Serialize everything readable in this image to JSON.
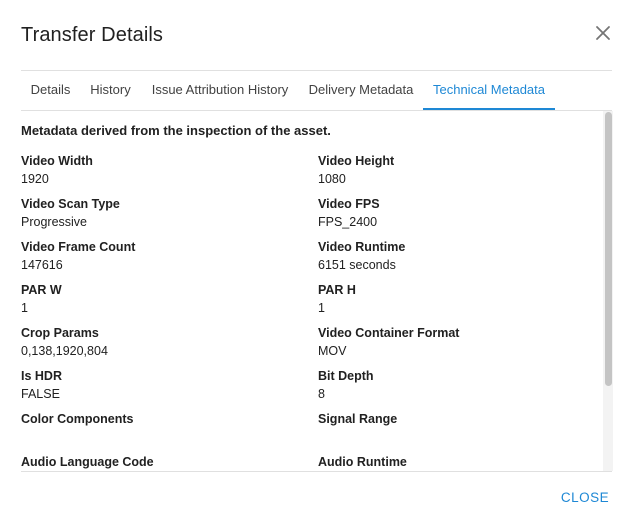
{
  "dialog": {
    "title": "Transfer Details",
    "close_icon": "close-icon",
    "footer_close_label": "CLOSE",
    "accent_color": "#1e88d5"
  },
  "tabs": [
    {
      "label": "Details",
      "active": false
    },
    {
      "label": "History",
      "active": false
    },
    {
      "label": "Issue Attribution History",
      "active": false
    },
    {
      "label": "Delivery Metadata",
      "active": false
    },
    {
      "label": "Technical Metadata",
      "active": true
    }
  ],
  "content": {
    "intro": "Metadata derived from the inspection of the asset.",
    "fields": [
      {
        "label": "Video Width",
        "value": "1920"
      },
      {
        "label": "Video Height",
        "value": "1080"
      },
      {
        "label": "Video Scan Type",
        "value": "Progressive"
      },
      {
        "label": "Video FPS",
        "value": "FPS_2400"
      },
      {
        "label": "Video Frame Count",
        "value": "147616"
      },
      {
        "label": "Video Runtime",
        "value": "6151 seconds"
      },
      {
        "label": "PAR W",
        "value": "1"
      },
      {
        "label": "PAR H",
        "value": "1"
      },
      {
        "label": "Crop Params",
        "value": "0,138,1920,804"
      },
      {
        "label": "Video Container Format",
        "value": "MOV"
      },
      {
        "label": "Is HDR",
        "value": "FALSE"
      },
      {
        "label": "Bit Depth",
        "value": "8"
      },
      {
        "label": "Color Components",
        "value": ""
      },
      {
        "label": "Signal Range",
        "value": ""
      },
      {
        "label": "Audio Language Code",
        "value": ""
      },
      {
        "label": "Audio Runtime",
        "value": ""
      }
    ]
  }
}
